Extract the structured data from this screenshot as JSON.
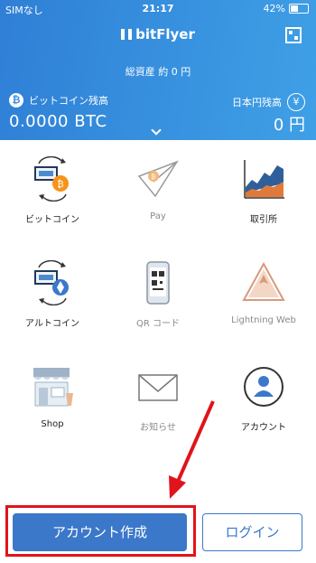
{
  "status_bar": {
    "carrier": "SIMなし",
    "time": "21:17",
    "battery": "42%"
  },
  "header": {
    "logo": "bitFlyer",
    "total_assets": "総資産 約 0 円",
    "btc_label": "ビットコイン残高",
    "btc_value": "0.0000 BTC",
    "jpy_label": "日本円残高",
    "jpy_value": "0 円"
  },
  "menu": {
    "items": [
      {
        "label": "ビットコイン",
        "icon": "bitcoin-exchange-icon"
      },
      {
        "label": "Pay",
        "icon": "paper-plane-icon"
      },
      {
        "label": "取引所",
        "icon": "chart-icon"
      },
      {
        "label": "アルトコイン",
        "icon": "altcoin-exchange-icon"
      },
      {
        "label": "QR コード",
        "icon": "qr-phone-icon"
      },
      {
        "label": "Lightning Web",
        "icon": "lightning-triangle-icon"
      },
      {
        "label": "Shop",
        "icon": "shop-icon"
      },
      {
        "label": "お知らせ",
        "icon": "envelope-icon"
      },
      {
        "label": "アカウント",
        "icon": "account-icon"
      }
    ]
  },
  "buttons": {
    "register": "アカウント作成",
    "login": "ログイン"
  },
  "colors": {
    "accent": "#3b78c9",
    "highlight": "#e0141a",
    "bitcoin": "#f7931a"
  }
}
